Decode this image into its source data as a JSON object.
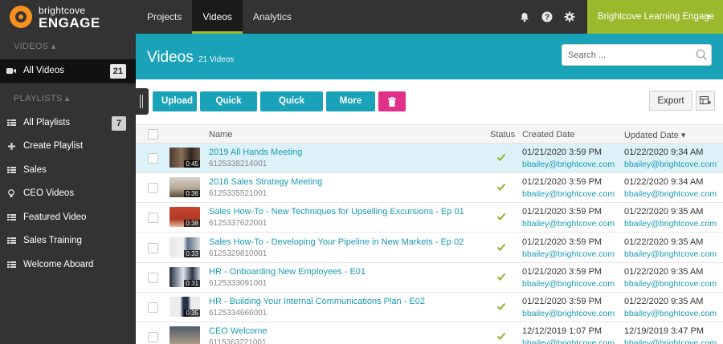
{
  "logo": {
    "top": "brightcove",
    "main": "ENGAGE"
  },
  "nav": {
    "items": [
      "Projects",
      "Videos",
      "Analytics"
    ],
    "active": "Videos"
  },
  "account": {
    "label": "Brightcove Learning Engage"
  },
  "icons": {
    "bell": "bell-icon",
    "help": "help-icon",
    "settings": "gear-icon",
    "search": "search-icon",
    "trash": "trash-icon",
    "columns": "columns-icon",
    "camera": "video-camera-icon"
  },
  "colors": {
    "accent": "#1aa3b8",
    "brand_green": "#9bb92c",
    "delete": "#e0308a",
    "dark": "#333333",
    "logo_orange": "#f7901e"
  },
  "sidebar": {
    "videos_heading": "VIDEOS ▴",
    "all_videos": {
      "label": "All Videos",
      "count": "21"
    },
    "playlists_heading": "PLAYLISTS ▴",
    "items": [
      {
        "label": "All Playlists",
        "count": "7"
      },
      {
        "label": "Create Playlist"
      },
      {
        "label": "Sales"
      },
      {
        "label": "CEO Videos"
      },
      {
        "label": "Featured Video"
      },
      {
        "label": "Sales Training"
      },
      {
        "label": "Welcome Aboard"
      }
    ]
  },
  "header": {
    "title": "Videos",
    "count": "21 Videos",
    "search_placeholder": "Search ..."
  },
  "toolbar": {
    "upload": "Upload",
    "quick_edit": "Quick Edit",
    "quick_view": "Quick View",
    "more": "More ▼",
    "export": "Export"
  },
  "table": {
    "columns": {
      "name": "Name",
      "status": "Status",
      "created": "Created Date",
      "updated": "Updated Date ▾"
    },
    "rows": [
      {
        "name": "2019 All Hands Meeting",
        "id": "6125338214001",
        "duration": "0:45",
        "created": "01/21/2020 3:59 PM",
        "created_by": "bbailey@brightcove.com",
        "updated": "01/22/2020 9:34 AM",
        "updated_by": "bbailey@brightcove.com",
        "selected": true
      },
      {
        "name": "2018 Sales Strategy Meeting",
        "id": "6125335521001",
        "duration": "0:36",
        "created": "01/21/2020 3:59 PM",
        "created_by": "bbailey@brightcove.com",
        "updated": "01/22/2020 9:34 AM",
        "updated_by": "bbailey@brightcove.com"
      },
      {
        "name": "Sales How-To - New Techniques for Upselling Excursions - Ep 01",
        "id": "6125337622001",
        "duration": "0:38",
        "created": "01/21/2020 3:59 PM",
        "created_by": "bbailey@brightcove.com",
        "updated": "01/22/2020 9:35 AM",
        "updated_by": "bbailey@brightcove.com"
      },
      {
        "name": "Sales How-To - Developing Your Pipeline in New Markets - Ep 02",
        "id": "6125329810001",
        "duration": "0:33",
        "created": "01/21/2020 3:59 PM",
        "created_by": "bbailey@brightcove.com",
        "updated": "01/22/2020 9:35 AM",
        "updated_by": "bbailey@brightcove.com"
      },
      {
        "name": "HR - Onboarding New Employees - E01",
        "id": "6125333091001",
        "duration": "0:31",
        "created": "01/21/2020 3:59 PM",
        "created_by": "bbailey@brightcove.com",
        "updated": "01/22/2020 9:35 AM",
        "updated_by": "bbailey@brightcove.com"
      },
      {
        "name": "HR - Building Your Internal Communications Plan - E02",
        "id": "6125334666001",
        "duration": "0:35",
        "created": "01/21/2020 3:59 PM",
        "created_by": "bbailey@brightcove.com",
        "updated": "01/22/2020 9:35 AM",
        "updated_by": "bbailey@brightcove.com"
      },
      {
        "name": "CEO Welcome",
        "id": "6115363221001",
        "duration": "",
        "created": "12/12/2019 1:07 PM",
        "created_by": "bbailey@brightcove.com",
        "updated": "12/19/2019 3:47 PM",
        "updated_by": "bbailey@brightcove.com"
      }
    ]
  }
}
